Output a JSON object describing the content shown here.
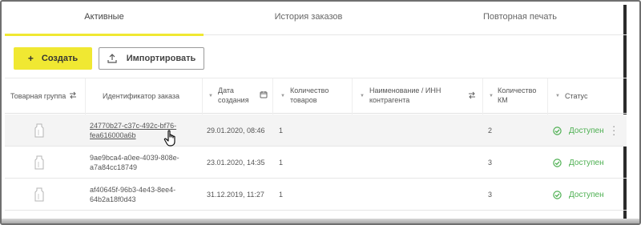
{
  "tabs": [
    {
      "label": "Активные",
      "active": true
    },
    {
      "label": "История заказов",
      "active": false
    },
    {
      "label": "Повторная печать",
      "active": false
    }
  ],
  "toolbar": {
    "create_label": "Создать",
    "import_label": "Импортировать"
  },
  "columns": {
    "product_group": "Товарная группа",
    "order_id": "Идентификатор заказа",
    "created_line1": "Дата",
    "created_line2": "создания",
    "goods_count_line1": "Количество",
    "goods_count_line2": "товаров",
    "counterparty_line1": "Наименование / ИНН",
    "counterparty_line2": "контрагента",
    "km_count_line1": "Количество",
    "km_count_line2": "КМ",
    "status": "Статус"
  },
  "rows": [
    {
      "id_line1": "24770b27-c37c-492c-bf76-",
      "id_line2": "fea616000a6b",
      "created": "29.01.2020, 08:46",
      "goods": "1",
      "counterparty": "",
      "km": "2",
      "status": "Доступен"
    },
    {
      "id_line1": "9ae9bca4-a0ee-4039-808e-",
      "id_line2": "a7a84cc18749",
      "created": "23.01.2020, 14:35",
      "goods": "1",
      "counterparty": "",
      "km": "3",
      "status": "Доступен"
    },
    {
      "id_line1": "af40645f-96b3-4e43-8ee4-",
      "id_line2": "64b2a18f0d43",
      "created": "31.12.2019, 11:27",
      "goods": "1",
      "counterparty": "",
      "km": "3",
      "status": "Доступен"
    }
  ],
  "colors": {
    "accent": "#f0e832",
    "status_ok": "#4caf50"
  }
}
